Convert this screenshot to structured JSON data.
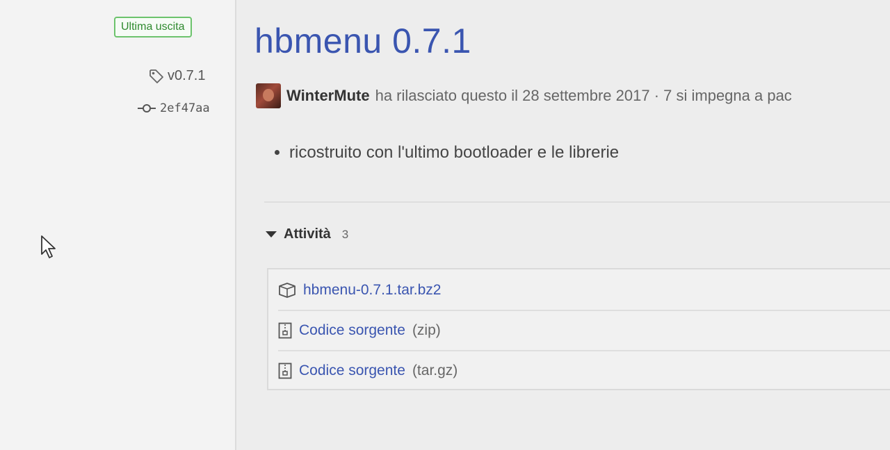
{
  "sidebar": {
    "latest_badge": "Ultima uscita",
    "tag": "v0.7.1",
    "commit": "2ef47aa"
  },
  "release": {
    "title": "hbmenu 0.7.1",
    "author": "WinterMute",
    "meta_text": "ha rilasciato questo il 28 settembre 2017 · 7 si impegna a pac",
    "notes": [
      "ricostruito con l'ultimo bootloader e le librerie"
    ]
  },
  "assets": {
    "header": "Attività",
    "count": "3",
    "items": [
      {
        "name": "hbmenu-0.7.1.tar.bz2",
        "suffix": "",
        "icon": "package-icon"
      },
      {
        "name": "Codice sorgente",
        "suffix": "(zip)",
        "icon": "file-zip-icon"
      },
      {
        "name": "Codice sorgente",
        "suffix": "(tar.gz)",
        "icon": "file-zip-icon"
      }
    ]
  },
  "colors": {
    "link": "#3a55b0",
    "badge_border": "#6cc36c",
    "badge_text": "#2f8a2f"
  }
}
